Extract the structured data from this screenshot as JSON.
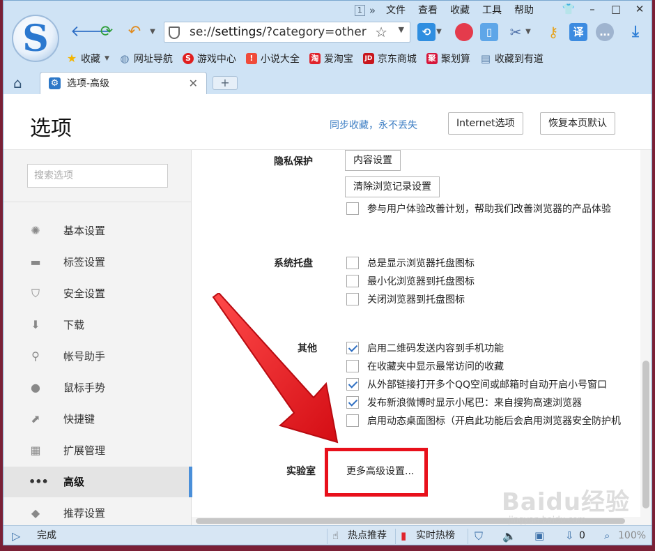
{
  "menus": {
    "page_indicator": "1",
    "more": "»",
    "items": [
      "文件",
      "查看",
      "收藏",
      "工具",
      "帮助"
    ]
  },
  "window_controls": {
    "skin": "👕",
    "minimize": "–",
    "maximize": "□",
    "close": "✕"
  },
  "logo_letter": "S",
  "address_bar": {
    "scheme": "se://",
    "path": "settings",
    "query": "/?category=other"
  },
  "bookmarks": [
    {
      "label": "收藏",
      "icon": "star-icon",
      "color": "#f3b400"
    },
    {
      "label": "网址导航",
      "icon": "globe-icon",
      "color": "#5a7fa8"
    },
    {
      "label": "游戏中心",
      "icon": "game-icon",
      "color": "#e01f1f"
    },
    {
      "label": "小说大全",
      "icon": "book-icon",
      "color": "#f04b3a"
    },
    {
      "label": "爱淘宝",
      "icon": "taobao-icon",
      "color": "#e0242c"
    },
    {
      "label": "京东商城",
      "icon": "jd-icon",
      "color": "#c8161d"
    },
    {
      "label": "聚划算",
      "icon": "juhuasuan-icon",
      "color": "#d6163a"
    },
    {
      "label": "收藏到有道",
      "icon": "doc-icon",
      "color": "#5a7fa8"
    }
  ],
  "tab": {
    "label": "选项-高级"
  },
  "header": {
    "title": "选项",
    "sync_link": "同步收藏，永不丢失",
    "internet_options": "Internet选项",
    "restore_defaults": "恢复本页默认"
  },
  "sidebar": {
    "search_placeholder": "搜索选项",
    "items": [
      {
        "label": "基本设置",
        "icon": "gear-icon",
        "glyph": "✺"
      },
      {
        "label": "标签设置",
        "icon": "tab-icon",
        "glyph": "▬"
      },
      {
        "label": "安全设置",
        "icon": "shield-icon",
        "glyph": "⛉"
      },
      {
        "label": "下载",
        "icon": "download-icon",
        "glyph": "⬇"
      },
      {
        "label": "帐号助手",
        "icon": "key-icon",
        "glyph": "⚲"
      },
      {
        "label": "鼠标手势",
        "icon": "mouse-icon",
        "glyph": "●"
      },
      {
        "label": "快捷键",
        "icon": "shortcut-icon",
        "glyph": "⬈"
      },
      {
        "label": "扩展管理",
        "icon": "extension-icon",
        "glyph": "▦"
      },
      {
        "label": "高级",
        "icon": "more-icon",
        "glyph": "•••"
      },
      {
        "label": "推荐设置",
        "icon": "diamond-icon",
        "glyph": "◆"
      }
    ]
  },
  "sections": {
    "privacy": {
      "label": "隐私保护",
      "content_settings": "内容设置",
      "clear_history": "清除浏览记录设置",
      "ux_program": "参与用户体验改善计划，帮助我们改善浏览器的产品体验"
    },
    "tray": {
      "label": "系统托盘",
      "options": [
        {
          "label": "总是显示浏览器托盘图标",
          "checked": false
        },
        {
          "label": "最小化浏览器到托盘图标",
          "checked": false
        },
        {
          "label": "关闭浏览器到托盘图标",
          "checked": false
        }
      ]
    },
    "other": {
      "label": "其他",
      "options": [
        {
          "label": "启用二维码发送内容到手机功能",
          "checked": true
        },
        {
          "label": "在收藏夹中显示最常访问的收藏",
          "checked": false
        },
        {
          "label": "从外部链接打开多个QQ空间或邮箱时自动开启小号窗口",
          "checked": true
        },
        {
          "label": "发布新浪微博时显示小尾巴：来自搜狗高速浏览器",
          "checked": true
        },
        {
          "label": "启用动态桌面图标（开启此功能后会启用浏览器安全防护机",
          "checked": false
        }
      ]
    },
    "lab": {
      "label": "实验室",
      "more_advanced": "更多高级设置..."
    }
  },
  "status_bar": {
    "done": "完成",
    "hot_recommend": "热点推荐",
    "realtime_hot": "实时热榜",
    "counter": "0",
    "zoom": "100%"
  },
  "watermark": {
    "brand": "Baidu经验",
    "url": "jingyan.baidu.com"
  },
  "colors": {
    "accent": "#4a8fd9",
    "highlight": "#e8101b",
    "link": "#3f7fc4"
  }
}
